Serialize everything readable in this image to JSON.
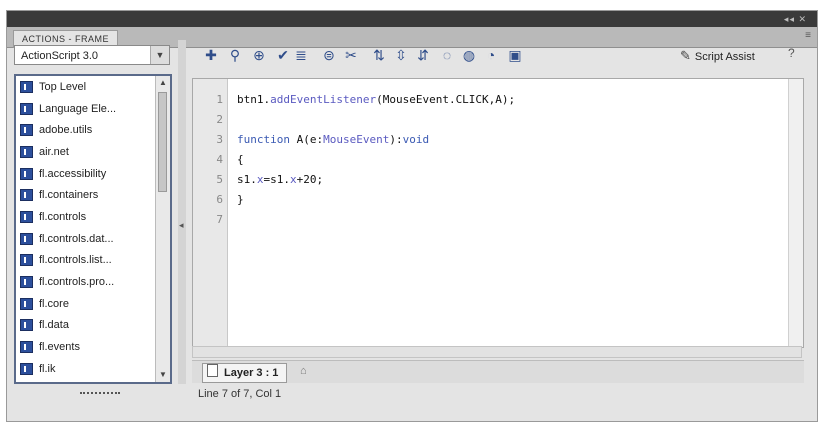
{
  "panel": {
    "tab_label": "ACTIONS - FRAME"
  },
  "language_select": {
    "value": "ActionScript 3.0"
  },
  "tree": {
    "items": [
      {
        "label": "Top Level"
      },
      {
        "label": "Language Ele..."
      },
      {
        "label": "adobe.utils"
      },
      {
        "label": "air.net"
      },
      {
        "label": "fl.accessibility"
      },
      {
        "label": "fl.containers"
      },
      {
        "label": "fl.controls"
      },
      {
        "label": "fl.controls.dat..."
      },
      {
        "label": "fl.controls.list..."
      },
      {
        "label": "fl.controls.pro..."
      },
      {
        "label": "fl.core"
      },
      {
        "label": "fl.data"
      },
      {
        "label": "fl.events"
      },
      {
        "label": "fl.ik"
      }
    ]
  },
  "toolbar": {
    "script_assist_label": "Script Assist"
  },
  "editor": {
    "line_numbers": [
      "1",
      "2",
      "3",
      "4",
      "5",
      "6",
      "7"
    ],
    "line1_a": "btn1.",
    "line1_b": "addEventListener",
    "line1_c": "(MouseEvent.CLICK,A);",
    "line3_a": "function",
    "line3_b": " A(e:",
    "line3_c": "MouseEvent",
    "line3_d": "):",
    "line3_e": "void",
    "line4": "{",
    "line5_a": "s1.",
    "line5_b": "x",
    "line5_c": "=s1.",
    "line5_d": "x",
    "line5_e": "+20;",
    "line6": "}"
  },
  "layer_tab": {
    "label": "Layer 3 : 1"
  },
  "status": {
    "text": "Line 7 of 7, Col 1"
  }
}
